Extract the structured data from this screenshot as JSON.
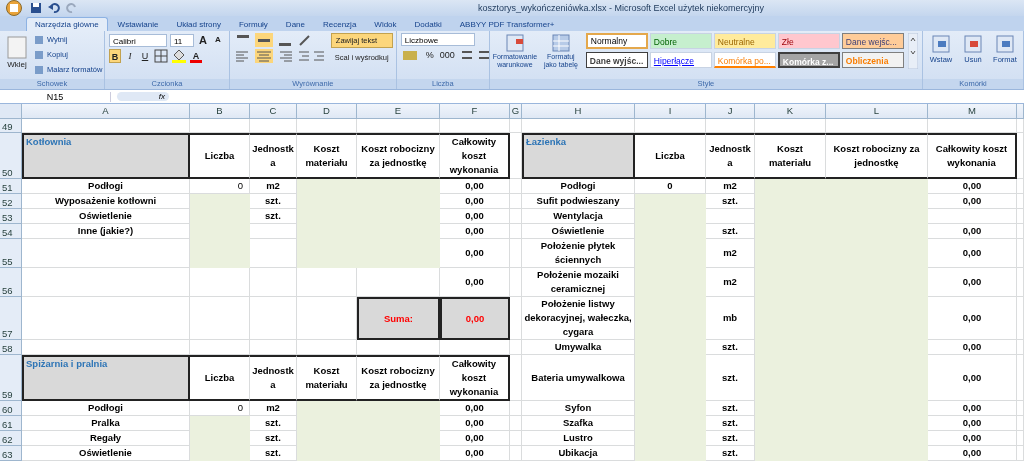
{
  "title": "kosztorys_wykończeniówka.xlsx - Microsoft Excel użytek niekomercyjny",
  "tabs": [
    {
      "label": "Narzędzia główne",
      "selected": true
    },
    {
      "label": "Wstawianie",
      "selected": false
    },
    {
      "label": "Układ strony",
      "selected": false
    },
    {
      "label": "Formuły",
      "selected": false
    },
    {
      "label": "Dane",
      "selected": false
    },
    {
      "label": "Recenzja",
      "selected": false
    },
    {
      "label": "Widok",
      "selected": false
    },
    {
      "label": "Dodatki",
      "selected": false
    },
    {
      "label": "ABBYY PDF Transformer+",
      "selected": false
    }
  ],
  "clipboard": {
    "paste": "Wklej",
    "items": [
      "Wytnij",
      "Kopiuj",
      "Malarz formatów"
    ],
    "label": "Schowek"
  },
  "font": {
    "name": "Calibri",
    "size": "11",
    "grow": "A",
    "shrink": "A",
    "styles": [
      {
        "label": "B",
        "selected": true
      },
      {
        "label": "I",
        "selected": false
      },
      {
        "label": "U",
        "selected": false
      }
    ],
    "color_letter": "A",
    "label": "Czcionka"
  },
  "alignment": {
    "vertical": [
      {
        "selected": false
      },
      {
        "selected": true
      },
      {
        "selected": false
      }
    ],
    "horizontal": [
      {
        "selected": false
      },
      {
        "selected": true
      },
      {
        "selected": false
      }
    ],
    "wrap": {
      "label": "Zawijaj tekst",
      "selected": true
    },
    "merge": "Scal i wyśrodkuj",
    "label": "Wyrównanie"
  },
  "number": {
    "format": "Liczbowe",
    "percent": "%",
    "thousands": "000",
    "label": "Liczba"
  },
  "styles": {
    "conditional": "Formatowanie warunkowe",
    "as_table": "Formatuj jako tabelę",
    "label": "Style",
    "gallery": [
      {
        "label": "Normalny",
        "kind": "normal",
        "selected": true
      },
      {
        "label": "Dobre",
        "kind": "good",
        "selected": false
      },
      {
        "label": "Neutralne",
        "kind": "neutral",
        "selected": false
      },
      {
        "label": "Złe",
        "kind": "bad",
        "selected": false
      },
      {
        "label": "Dane wejśc...",
        "kind": "input",
        "selected": false
      },
      {
        "label": "Dane wyjśc...",
        "kind": "output",
        "selected": false
      },
      {
        "label": "Hiperłącze",
        "kind": "link",
        "selected": false
      },
      {
        "label": "Komórka po...",
        "kind": "linked",
        "selected": false
      },
      {
        "label": "Komórka z...",
        "kind": "check",
        "selected": false
      },
      {
        "label": "Obliczenia",
        "kind": "calc",
        "selected": false
      }
    ]
  },
  "cells_group": {
    "buttons": [
      "Wstaw",
      "Usuń",
      "Format"
    ],
    "label": "Komórki"
  },
  "name_box": "N15",
  "fx": "fx",
  "sheet": {
    "columns": [
      "A",
      "B",
      "C",
      "D",
      "E",
      "F",
      "G",
      "H",
      "I",
      "J",
      "K",
      "L",
      "M"
    ],
    "rows": [
      {
        "number": "49",
        "cells": [
          {
            "kind": "blank"
          },
          {
            "kind": "blank"
          },
          {
            "kind": "blank"
          },
          {
            "kind": "blank"
          },
          {
            "kind": "blank"
          },
          {
            "kind": "blank"
          },
          {
            "kind": "blank"
          },
          {
            "kind": "blank"
          },
          {
            "kind": "blank"
          },
          {
            "kind": "blank"
          },
          {
            "kind": "blank"
          },
          {
            "kind": "blank"
          },
          {
            "kind": "blank"
          }
        ]
      },
      {
        "number": "50",
        "cells": [
          {
            "kind": "title",
            "text": "Kotłownia"
          },
          {
            "kind": "head",
            "text": "Liczba"
          },
          {
            "kind": "head",
            "text": "Jednostka"
          },
          {
            "kind": "head",
            "text": "Koszt materiału"
          },
          {
            "kind": "head",
            "text": "Koszt robocizny za jednostkę"
          },
          {
            "kind": "head",
            "text": "Całkowity koszt wykonania"
          },
          {
            "kind": "blank"
          },
          {
            "kind": "title",
            "text": "Łazienka"
          },
          {
            "kind": "head",
            "text": "Liczba"
          },
          {
            "kind": "head",
            "text": "Jednostka"
          },
          {
            "kind": "head",
            "text": "Koszt materiału"
          },
          {
            "kind": "head",
            "text": "Koszt robocizny za jednostkę"
          },
          {
            "kind": "head",
            "text": "Całkowity koszt wykonania"
          }
        ]
      },
      {
        "number": "51",
        "cells": [
          {
            "kind": "label",
            "text": "Podłogi"
          },
          {
            "kind": "count",
            "text": "0"
          },
          {
            "kind": "label",
            "text": "m2"
          },
          {
            "kind": "input"
          },
          {
            "kind": "input"
          },
          {
            "kind": "label",
            "text": "0,00"
          },
          {
            "kind": "blank"
          },
          {
            "kind": "label",
            "text": "Podłogi"
          },
          {
            "kind": "label",
            "text": "0"
          },
          {
            "kind": "label",
            "text": "m2"
          },
          {
            "kind": "input"
          },
          {
            "kind": "input"
          },
          {
            "kind": "label",
            "text": "0,00"
          }
        ]
      },
      {
        "number": "52",
        "cells": [
          {
            "kind": "label",
            "text": "Wyposażenie kotłowni"
          },
          {
            "kind": "input"
          },
          {
            "kind": "label",
            "text": "szt."
          },
          {
            "kind": "input"
          },
          {
            "kind": "input"
          },
          {
            "kind": "label",
            "text": "0,00"
          },
          {
            "kind": "blank"
          },
          {
            "kind": "label",
            "text": "Sufit podwieszany"
          },
          {
            "kind": "input"
          },
          {
            "kind": "label",
            "text": "szt."
          },
          {
            "kind": "input"
          },
          {
            "kind": "input"
          },
          {
            "kind": "label",
            "text": "0,00"
          }
        ]
      },
      {
        "number": "53",
        "cells": [
          {
            "kind": "label",
            "text": "Oświetlenie"
          },
          {
            "kind": "input"
          },
          {
            "kind": "label",
            "text": "szt."
          },
          {
            "kind": "input"
          },
          {
            "kind": "input"
          },
          {
            "kind": "label",
            "text": "0,00"
          },
          {
            "kind": "blank"
          },
          {
            "kind": "label",
            "text": "Wentylacja"
          },
          {
            "kind": "input"
          },
          {
            "kind": "blank"
          },
          {
            "kind": "input"
          },
          {
            "kind": "input"
          },
          {
            "kind": "blank"
          }
        ]
      },
      {
        "number": "54",
        "cells": [
          {
            "kind": "label",
            "text": "Inne (jakie?)"
          },
          {
            "kind": "input"
          },
          {
            "kind": "blank"
          },
          {
            "kind": "input"
          },
          {
            "kind": "input"
          },
          {
            "kind": "label",
            "text": "0,00"
          },
          {
            "kind": "blank"
          },
          {
            "kind": "label",
            "text": "Oświetlenie"
          },
          {
            "kind": "input"
          },
          {
            "kind": "label",
            "text": "szt."
          },
          {
            "kind": "input"
          },
          {
            "kind": "input"
          },
          {
            "kind": "label",
            "text": "0,00"
          }
        ]
      },
      {
        "number": "55",
        "cells": [
          {
            "kind": "blank"
          },
          {
            "kind": "input"
          },
          {
            "kind": "blank"
          },
          {
            "kind": "input"
          },
          {
            "kind": "input"
          },
          {
            "kind": "label",
            "text": "0,00"
          },
          {
            "kind": "blank"
          },
          {
            "kind": "label",
            "text": "Położenie płytek ściennych"
          },
          {
            "kind": "input"
          },
          {
            "kind": "label",
            "text": "m2"
          },
          {
            "kind": "input"
          },
          {
            "kind": "input"
          },
          {
            "kind": "label",
            "text": "0,00"
          }
        ]
      },
      {
        "number": "56",
        "cells": [
          {
            "kind": "blank"
          },
          {
            "kind": "blank"
          },
          {
            "kind": "blank"
          },
          {
            "kind": "blank"
          },
          {
            "kind": "blank"
          },
          {
            "kind": "label",
            "text": "0,00"
          },
          {
            "kind": "blank"
          },
          {
            "kind": "label",
            "text": "Położenie mozaiki ceramicznej"
          },
          {
            "kind": "input"
          },
          {
            "kind": "label",
            "text": "m2"
          },
          {
            "kind": "input"
          },
          {
            "kind": "input"
          },
          {
            "kind": "label",
            "text": "0,00"
          }
        ]
      },
      {
        "number": "57",
        "cells": [
          {
            "kind": "blank"
          },
          {
            "kind": "blank"
          },
          {
            "kind": "blank"
          },
          {
            "kind": "blank"
          },
          {
            "kind": "sum",
            "text": "Suma:"
          },
          {
            "kind": "sum",
            "text": "0,00"
          },
          {
            "kind": "blank"
          },
          {
            "kind": "label",
            "text": "Położenie listwy dekoracyjnej, wałeczka, cygara"
          },
          {
            "kind": "input"
          },
          {
            "kind": "label",
            "text": "mb"
          },
          {
            "kind": "input"
          },
          {
            "kind": "input"
          },
          {
            "kind": "label",
            "text": "0,00"
          }
        ]
      },
      {
        "number": "58",
        "cells": [
          {
            "kind": "blank"
          },
          {
            "kind": "blank"
          },
          {
            "kind": "blank"
          },
          {
            "kind": "blank"
          },
          {
            "kind": "blank"
          },
          {
            "kind": "blank"
          },
          {
            "kind": "blank"
          },
          {
            "kind": "label",
            "text": "Umywalka"
          },
          {
            "kind": "input"
          },
          {
            "kind": "label",
            "text": "szt."
          },
          {
            "kind": "input"
          },
          {
            "kind": "input"
          },
          {
            "kind": "label",
            "text": "0,00"
          }
        ]
      },
      {
        "number": "59",
        "cells": [
          {
            "kind": "title",
            "text": "Spiżarnia i pralnia"
          },
          {
            "kind": "head",
            "text": "Liczba"
          },
          {
            "kind": "head",
            "text": "Jednostka"
          },
          {
            "kind": "head",
            "text": "Koszt materiału"
          },
          {
            "kind": "head",
            "text": "Koszt robocizny za jednostkę"
          },
          {
            "kind": "head",
            "text": "Całkowity koszt wykonania"
          },
          {
            "kind": "blank"
          },
          {
            "kind": "label",
            "text": "Bateria umywalkowa"
          },
          {
            "kind": "input"
          },
          {
            "kind": "label",
            "text": "szt."
          },
          {
            "kind": "input"
          },
          {
            "kind": "input"
          },
          {
            "kind": "label",
            "text": "0,00"
          }
        ]
      },
      {
        "number": "60",
        "cells": [
          {
            "kind": "label",
            "text": "Podłogi"
          },
          {
            "kind": "count",
            "text": "0"
          },
          {
            "kind": "label",
            "text": "m2"
          },
          {
            "kind": "input"
          },
          {
            "kind": "input"
          },
          {
            "kind": "label",
            "text": "0,00"
          },
          {
            "kind": "blank"
          },
          {
            "kind": "label",
            "text": "Syfon"
          },
          {
            "kind": "input"
          },
          {
            "kind": "label",
            "text": "szt."
          },
          {
            "kind": "input"
          },
          {
            "kind": "input"
          },
          {
            "kind": "label",
            "text": "0,00"
          }
        ]
      },
      {
        "number": "61",
        "cells": [
          {
            "kind": "label",
            "text": "Pralka"
          },
          {
            "kind": "input"
          },
          {
            "kind": "label",
            "text": "szt."
          },
          {
            "kind": "input"
          },
          {
            "kind": "input"
          },
          {
            "kind": "label",
            "text": "0,00"
          },
          {
            "kind": "blank"
          },
          {
            "kind": "label",
            "text": "Szafka"
          },
          {
            "kind": "input"
          },
          {
            "kind": "label",
            "text": "szt."
          },
          {
            "kind": "input"
          },
          {
            "kind": "input"
          },
          {
            "kind": "label",
            "text": "0,00"
          }
        ]
      },
      {
        "number": "62",
        "cells": [
          {
            "kind": "label",
            "text": "Regały"
          },
          {
            "kind": "input"
          },
          {
            "kind": "label",
            "text": "szt."
          },
          {
            "kind": "input"
          },
          {
            "kind": "input"
          },
          {
            "kind": "label",
            "text": "0,00"
          },
          {
            "kind": "blank"
          },
          {
            "kind": "label",
            "text": "Lustro"
          },
          {
            "kind": "input"
          },
          {
            "kind": "label",
            "text": "szt."
          },
          {
            "kind": "input"
          },
          {
            "kind": "input"
          },
          {
            "kind": "label",
            "text": "0,00"
          }
        ]
      },
      {
        "number": "63",
        "cells": [
          {
            "kind": "label",
            "text": "Oświetlenie"
          },
          {
            "kind": "input"
          },
          {
            "kind": "label",
            "text": "szt."
          },
          {
            "kind": "input"
          },
          {
            "kind": "input"
          },
          {
            "kind": "label",
            "text": "0,00"
          },
          {
            "kind": "blank"
          },
          {
            "kind": "label",
            "text": "Ubikacja"
          },
          {
            "kind": "input"
          },
          {
            "kind": "label",
            "text": "szt."
          },
          {
            "kind": "input"
          },
          {
            "kind": "input"
          },
          {
            "kind": "label",
            "text": "0,00"
          }
        ]
      }
    ]
  }
}
